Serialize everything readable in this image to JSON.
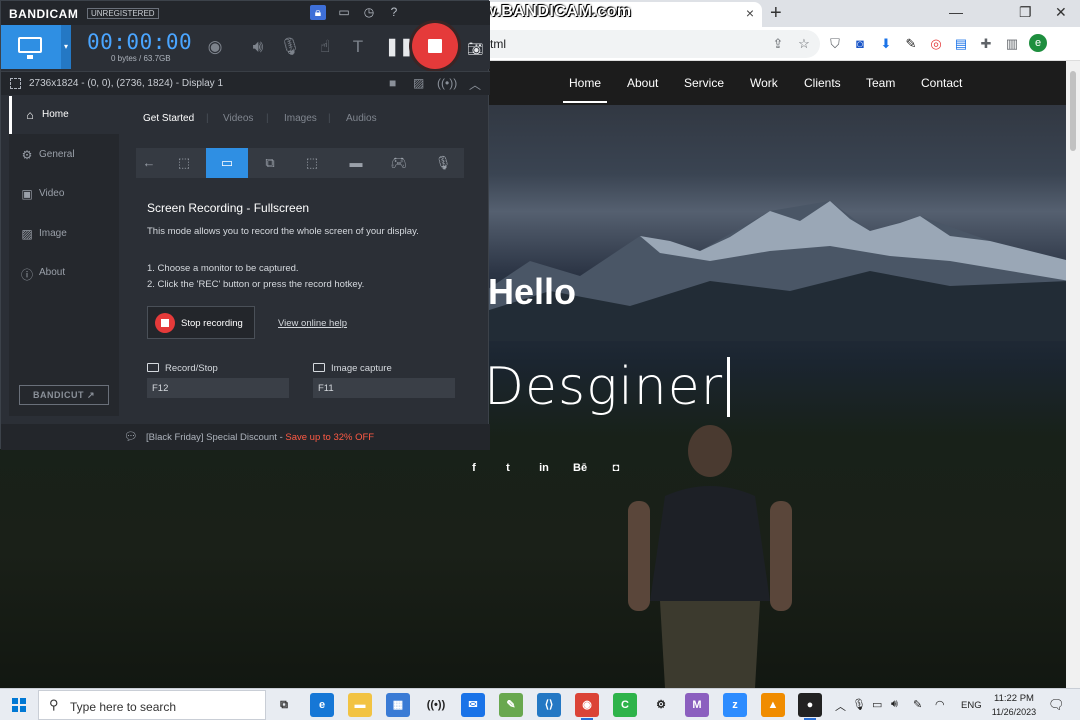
{
  "watermark": "www.BANDICAM.com",
  "browser": {
    "url_fragment": "tml",
    "tab_close": "×",
    "new_tab": "+",
    "profile_initial": "e",
    "window_controls": [
      "—",
      "❐",
      "✕"
    ],
    "toolbar_icons": [
      "share-icon",
      "star-icon",
      "shield-icon",
      "extension-icon",
      "download-icon",
      "eyedropper-icon",
      "capture-icon",
      "extension-icon",
      "puzzle-icon",
      "sidepanel-icon"
    ]
  },
  "site": {
    "nav": [
      "Home",
      "About",
      "Service",
      "Work",
      "Clients",
      "Team",
      "Contact"
    ],
    "active_nav": "Home",
    "hello": "Hello",
    "role": "Desginer",
    "social": [
      "f",
      "t",
      "in",
      "Bē",
      "◘"
    ]
  },
  "bandicam": {
    "logo": "BANDICAM",
    "unregistered": "UNREGISTERED",
    "timer": "00:00:00",
    "size": "0 bytes / 63.7GB",
    "target": "2736x1824 - (0, 0), (2736, 1824) - Display 1",
    "sidebar": [
      {
        "label": "Home",
        "icon": "home-icon",
        "glyph": "⌂"
      },
      {
        "label": "General",
        "icon": "gear-icon",
        "glyph": "⚙"
      },
      {
        "label": "Video",
        "icon": "video-icon",
        "glyph": "▣"
      },
      {
        "label": "Image",
        "icon": "image-icon",
        "glyph": "▨"
      },
      {
        "label": "About",
        "icon": "info-icon",
        "glyph": "ⓘ"
      }
    ],
    "bandicut": "BANDICUT ↗",
    "subtabs": [
      "Get Started",
      "Videos",
      "Images",
      "Audios"
    ],
    "heading": "Screen Recording - Fullscreen",
    "description": "This mode allows you to record the whole screen of your display.",
    "steps": [
      "1. Choose a monitor to be captured.",
      "2. Click the 'REC' button or press the record hotkey."
    ],
    "stop_recording": "Stop recording",
    "view_help": "View online help",
    "hotkeys": [
      {
        "label": "Record/Stop",
        "value": "F12"
      },
      {
        "label": "Image capture",
        "value": "F11"
      }
    ],
    "footer_text": "[Black Friday] Special Discount - ",
    "footer_hot": "Save up to 32% OFF"
  },
  "taskbar": {
    "search_placeholder": "Type here to search",
    "language": "ENG",
    "time": "11:22 PM",
    "date": "11/26/2023"
  }
}
